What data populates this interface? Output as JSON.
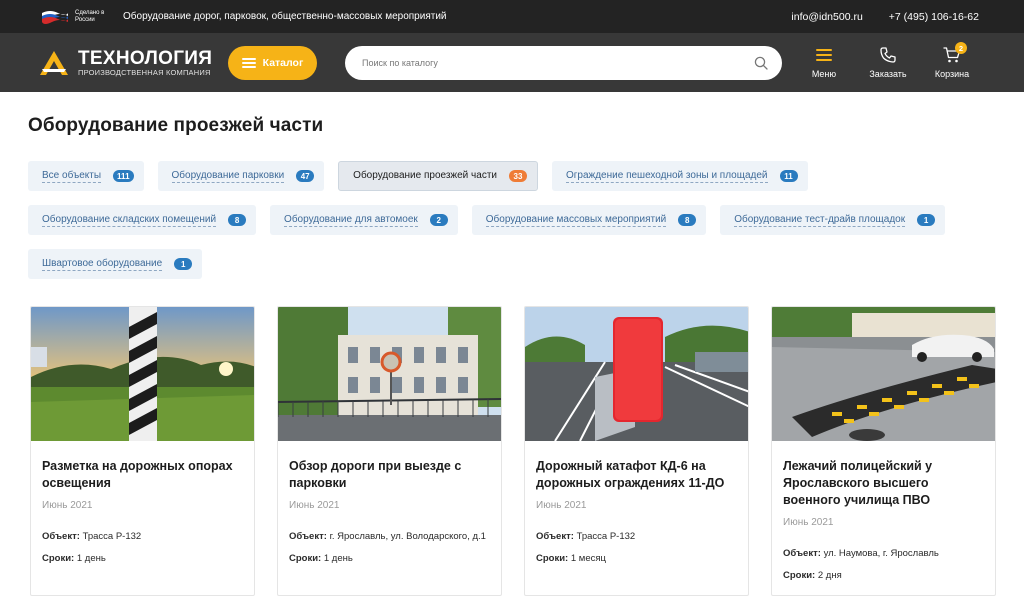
{
  "topbar": {
    "made_in": "Сделано в России",
    "description": "Оборудование дорог, парковок, общественно-массовых мероприятий",
    "email": "info@idn500.ru",
    "phone": "+7 (495) 106-16-62"
  },
  "header": {
    "logo_main": "ТЕХНОЛОГИЯ",
    "logo_sub": "ПРОИЗВОДСТВЕННАЯ КОМПАНИЯ",
    "catalog_label": "Каталог",
    "search_placeholder": "Поиск по каталогу",
    "menu_label": "Меню",
    "call_label": "Заказать",
    "cart_label": "Корзина",
    "cart_count": "2",
    "accent_color": "#f6b317"
  },
  "page": {
    "title": "Оборудование проезжей части"
  },
  "filters": [
    {
      "label": "Все объекты",
      "count": "111"
    },
    {
      "label": "Оборудование парковки",
      "count": "47"
    },
    {
      "label": "Оборудование проезжей части",
      "count": "33",
      "active": true
    },
    {
      "label": "Ограждение пешеходной зоны и площадей",
      "count": "11"
    },
    {
      "label": "Оборудование складских помещений",
      "count": "8"
    },
    {
      "label": "Оборудование для автомоек",
      "count": "2"
    },
    {
      "label": "Оборудование массовых мероприятий",
      "count": "8"
    },
    {
      "label": "Оборудование тест-драйв площадок",
      "count": "1"
    },
    {
      "label": "Швартовое оборудование",
      "count": "1"
    }
  ],
  "cards": [
    {
      "title": "Разметка на дорожных опорах освещения",
      "date": "Июнь 2021",
      "object_label": "Объект:",
      "object": "Трасса Р-132",
      "term_label": "Сроки:",
      "term": "1 день"
    },
    {
      "title": "Обзор дороги при выезде с парковки",
      "date": "Июнь 2021",
      "object_label": "Объект:",
      "object": "г. Ярославль, ул. Володарского, д.1",
      "term_label": "Сроки:",
      "term": "1 день"
    },
    {
      "title": "Дорожный катафот КД-6 на дорожных ограждениях 11-ДО",
      "date": "Июнь 2021",
      "object_label": "Объект:",
      "object": "Трасса Р-132",
      "term_label": "Сроки:",
      "term": "1 месяц"
    },
    {
      "title": "Лежачий полицейский у Ярославского высшего военного училища ПВО",
      "date": "Июнь 2021",
      "object_label": "Объект:",
      "object": "ул. Наумова, г. Ярославль",
      "term_label": "Сроки:",
      "term": "2 дня"
    }
  ]
}
